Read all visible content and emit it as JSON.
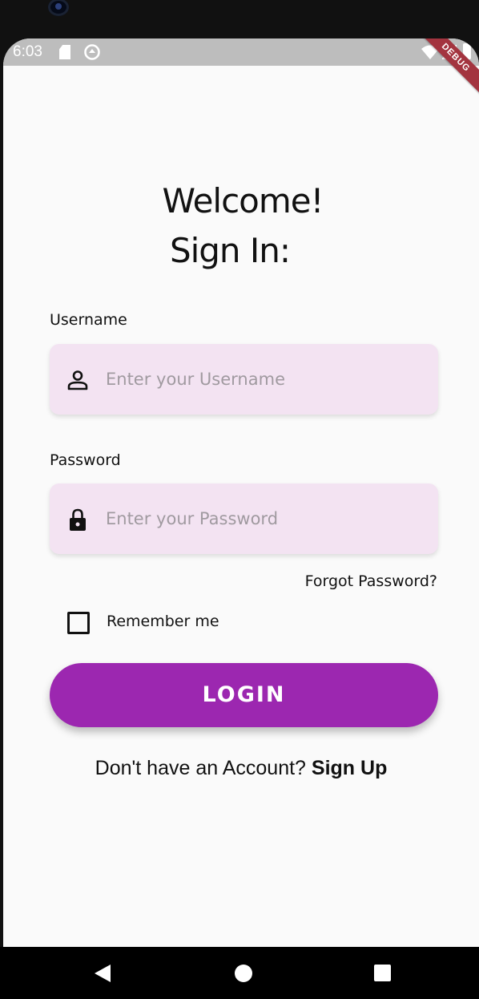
{
  "status_bar": {
    "time": "6:03",
    "debug_banner": "DEBUG"
  },
  "header": {
    "title_line1": "Welcome!",
    "title_line2": "Sign In:"
  },
  "form": {
    "username": {
      "label": "Username",
      "placeholder": "Enter your Username",
      "value": "",
      "icon": "person-icon"
    },
    "password": {
      "label": "Password",
      "placeholder": "Enter your Password",
      "value": "",
      "icon": "lock-icon"
    },
    "forgot_password": "Forgot Password?",
    "remember_me": {
      "label": "Remember me",
      "checked": false
    },
    "login_label": "LOGIN"
  },
  "signup": {
    "prompt": "Don't have an Account? ",
    "link": "Sign Up"
  },
  "nav": {
    "back": "back-icon",
    "home": "home-icon",
    "recents": "recents-icon"
  },
  "colors": {
    "accent": "#9c27b0",
    "field_background": "#f3e3f2",
    "screen_background": "#fafafa",
    "status_bar": "#bdbdbd",
    "debug_ribbon": "#a3343f"
  }
}
